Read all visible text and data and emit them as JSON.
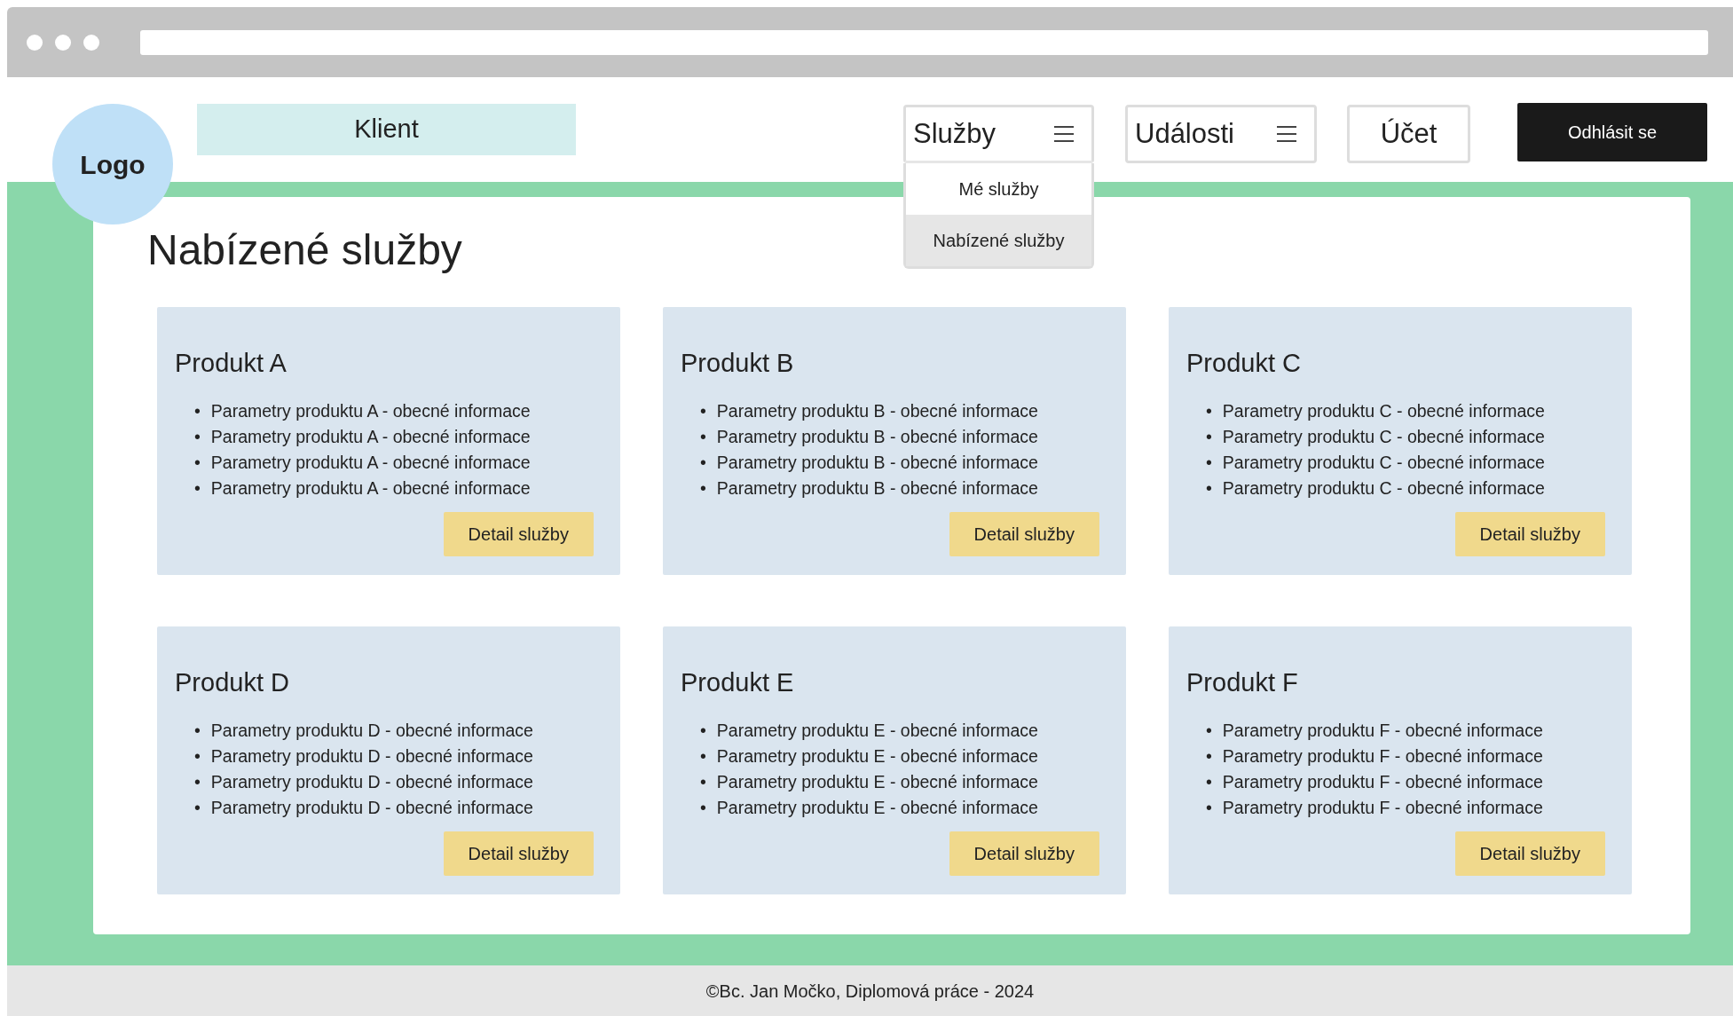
{
  "logo": "Logo",
  "client_label": "Klient",
  "nav": [
    {
      "label": "Služby",
      "kind": "dropdown",
      "expanded": true,
      "menu": [
        {
          "label": "Mé služby",
          "selected": false
        },
        {
          "label": "Nabízené služby",
          "selected": true
        }
      ]
    },
    {
      "label": "Události",
      "kind": "dropdown"
    },
    {
      "label": "Účet",
      "kind": "button"
    }
  ],
  "logout": "Odhlásit se",
  "heading": "Nabízené služby",
  "products": [
    {
      "title": "Produkt A",
      "params": [
        {
          "bullet": "•",
          "text": "Parametry produktu A - obecné informace"
        },
        {
          "bullet": "•",
          "text": "Parametry produktu A - obecné informace"
        },
        {
          "bullet": "•",
          "text": "Parametry produktu A - obecné informace"
        },
        {
          "bullet": "•",
          "text": "Parametry produktu A - obecné informace"
        }
      ],
      "button": "Detail služby"
    },
    {
      "title": "Produkt B",
      "params": [
        {
          "bullet": "•",
          "text": "Parametry produktu B - obecné informace"
        },
        {
          "bullet": "•",
          "text": "Parametry produktu B - obecné informace"
        },
        {
          "bullet": "•",
          "text": "Parametry produktu B - obecné informace"
        },
        {
          "bullet": "•",
          "text": "Parametry produktu B - obecné informace"
        }
      ],
      "button": "Detail služby"
    },
    {
      "title": "Produkt C",
      "params": [
        {
          "bullet": "•",
          "text": "Parametry produktu C - obecné informace"
        },
        {
          "bullet": "•",
          "text": "Parametry produktu C - obecné informace"
        },
        {
          "bullet": "•",
          "text": "Parametry produktu C - obecné informace"
        },
        {
          "bullet": "•",
          "text": "Parametry produktu C - obecné informace"
        }
      ],
      "button": "Detail služby"
    },
    {
      "title": "Produkt D",
      "params": [
        {
          "bullet": "•",
          "text": "Parametry produktu D - obecné informace"
        },
        {
          "bullet": "•",
          "text": "Parametry produktu D - obecné informace"
        },
        {
          "bullet": "•",
          "text": "Parametry produktu D - obecné informace"
        },
        {
          "bullet": "•",
          "text": "Parametry produktu D - obecné informace"
        }
      ],
      "button": "Detail služby"
    },
    {
      "title": "Produkt E",
      "params": [
        {
          "bullet": "•",
          "text": "Parametry produktu E - obecné informace"
        },
        {
          "bullet": "•",
          "text": "Parametry produktu E - obecné informace"
        },
        {
          "bullet": "•",
          "text": "Parametry produktu E - obecné informace"
        },
        {
          "bullet": "•",
          "text": "Parametry produktu E - obecné informace"
        }
      ],
      "button": "Detail služby"
    },
    {
      "title": "Produkt F",
      "params": [
        {
          "bullet": "•",
          "text": "Parametry produktu F - obecné informace"
        },
        {
          "bullet": "•",
          "text": "Parametry produktu F - obecné informace"
        },
        {
          "bullet": "•",
          "text": "Parametry produktu F - obecné informace"
        },
        {
          "bullet": "•",
          "text": "Parametry produktu F - obecné informace"
        }
      ],
      "button": "Detail služby"
    }
  ],
  "footer": "©Bc. Jan Močko, Diplomová práce - 2024"
}
